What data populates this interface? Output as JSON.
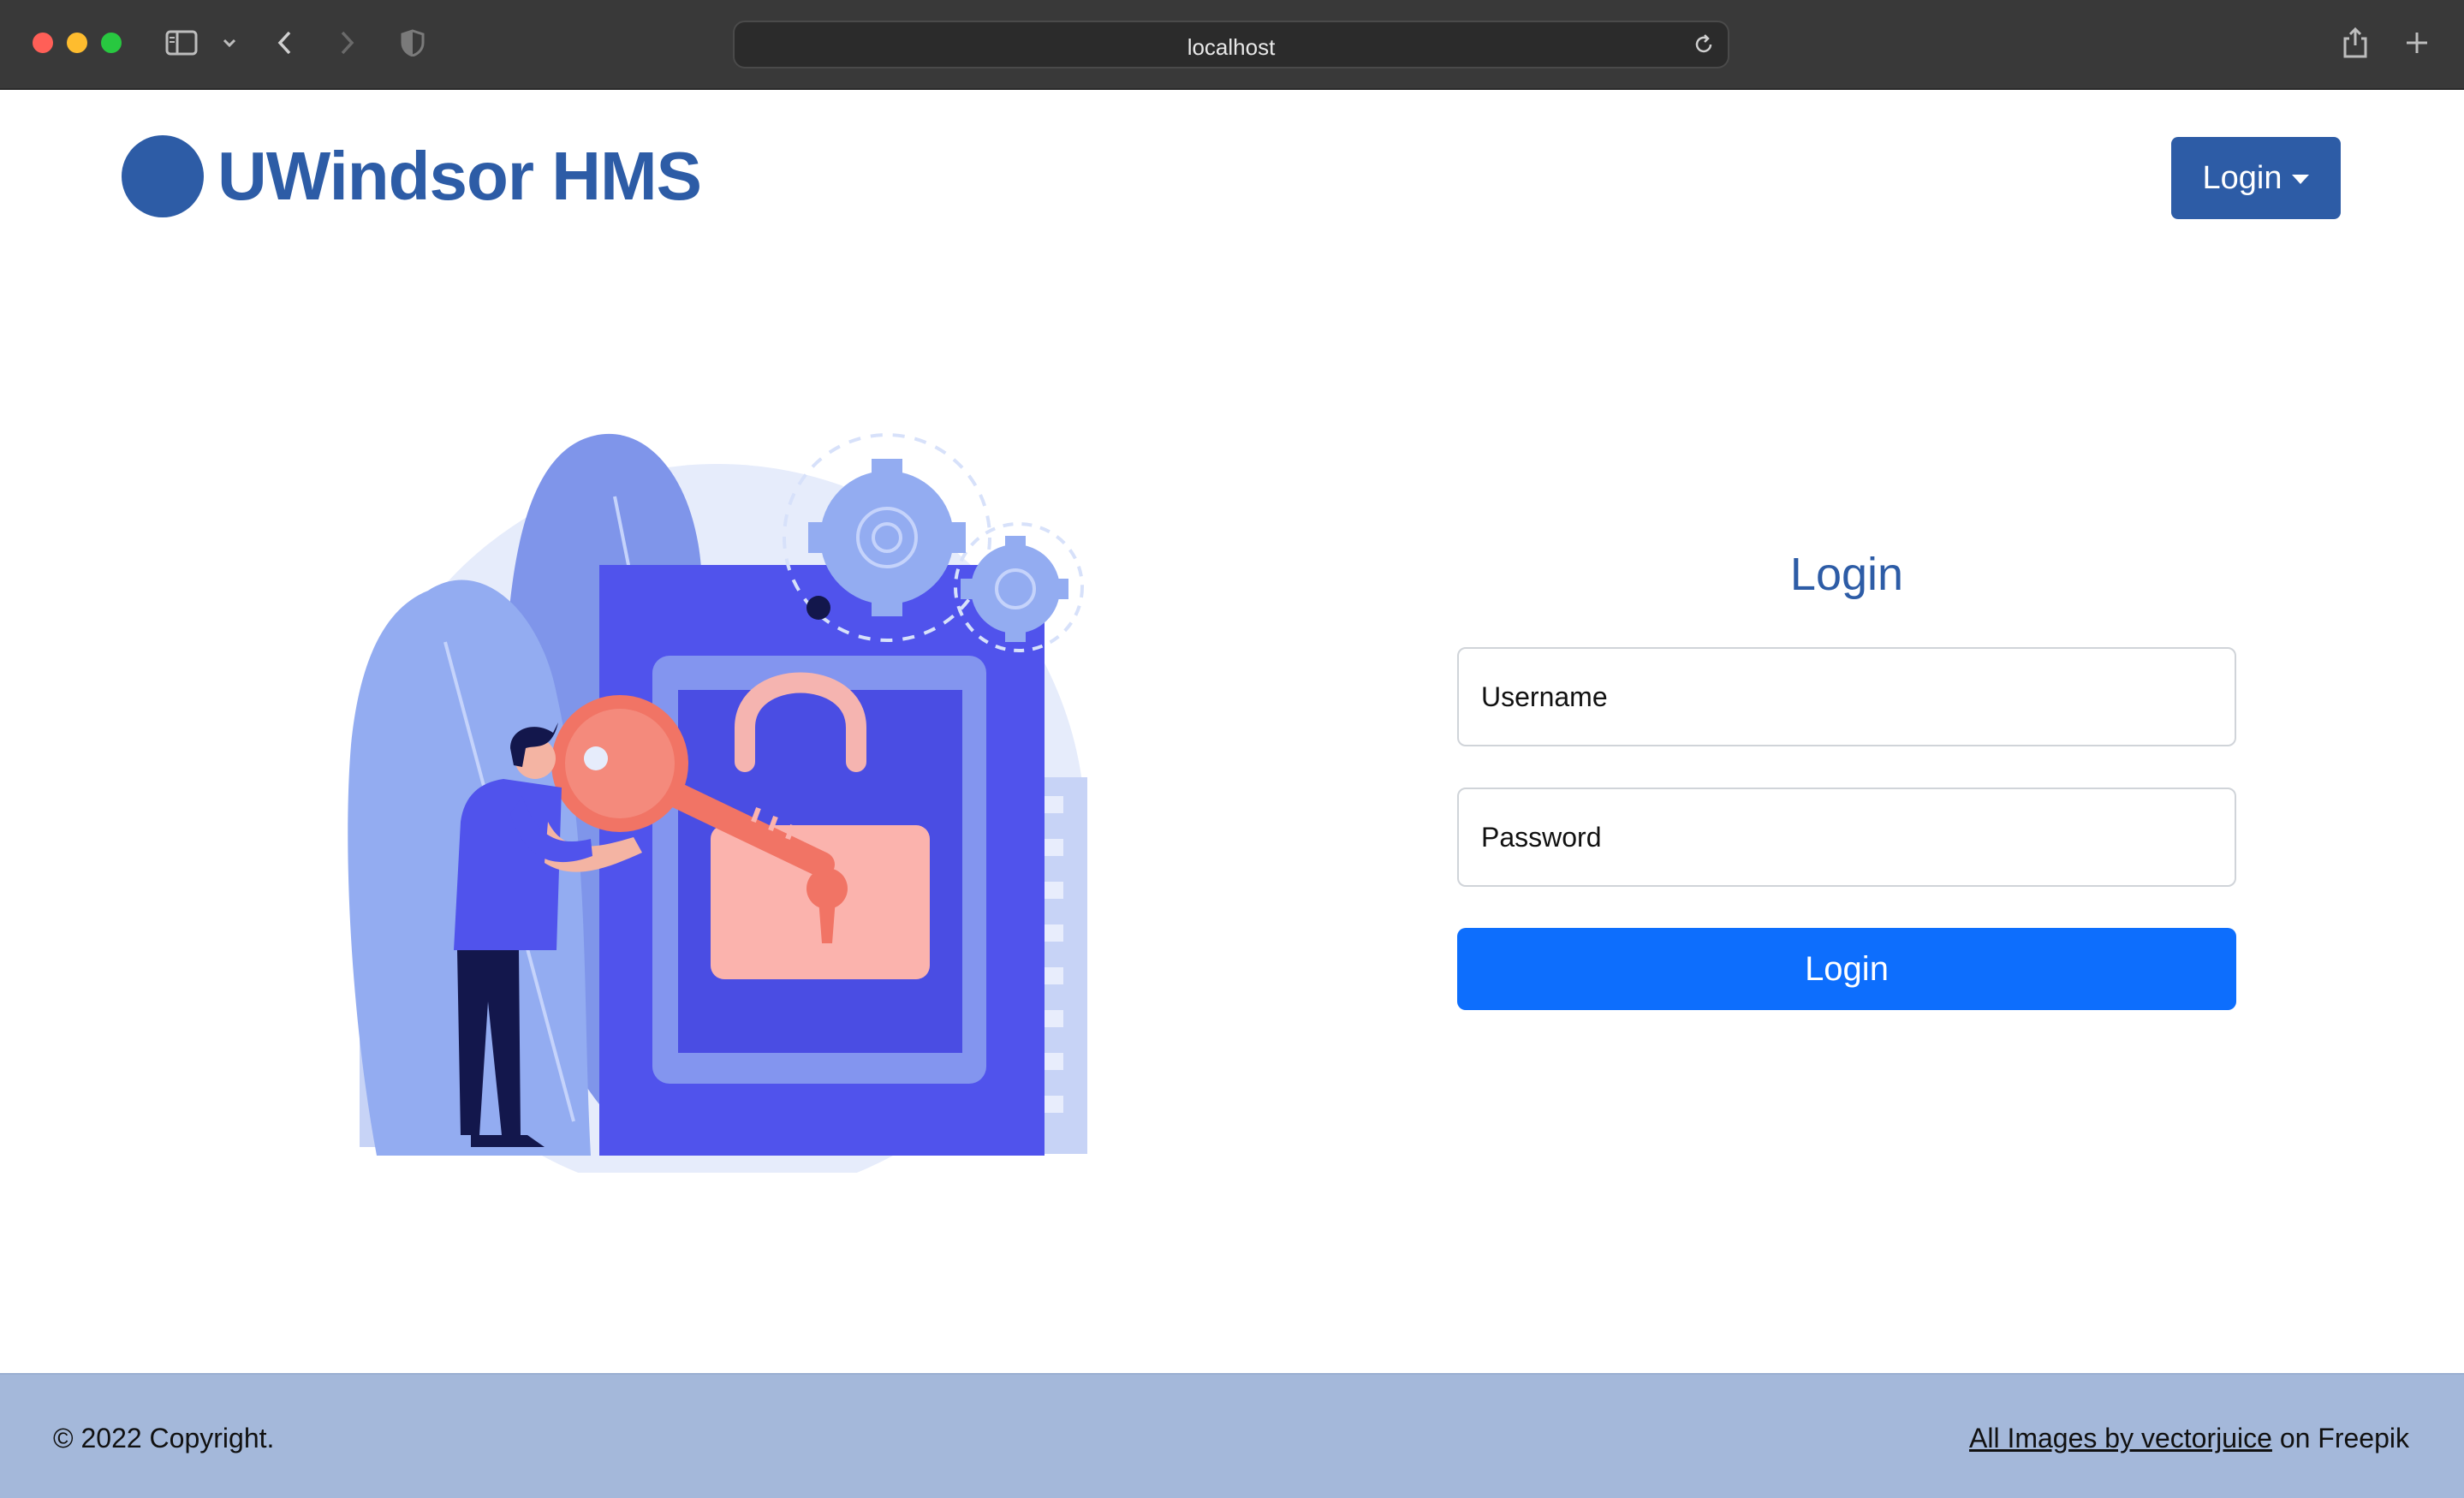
{
  "browser": {
    "url": "localhost",
    "icons": [
      "sidebar-icon",
      "chevron-down-icon",
      "back-icon",
      "forward-icon",
      "shield-icon",
      "reload-icon",
      "share-icon",
      "new-tab-icon"
    ]
  },
  "header": {
    "brand": "UWindsor HMS",
    "login_dropdown": "Login"
  },
  "form": {
    "title": "Login",
    "username_placeholder": "Username",
    "password_placeholder": "Password",
    "submit_label": "Login"
  },
  "footer": {
    "copyright": "© 2022 Copyright.",
    "credit_link": "All Images by vectorjuice",
    "credit_suffix": " on Freepik"
  },
  "colors": {
    "brand": "#2d5ca6",
    "primary_button": "#0d6efd",
    "footer_bg": "#a4b8da"
  }
}
